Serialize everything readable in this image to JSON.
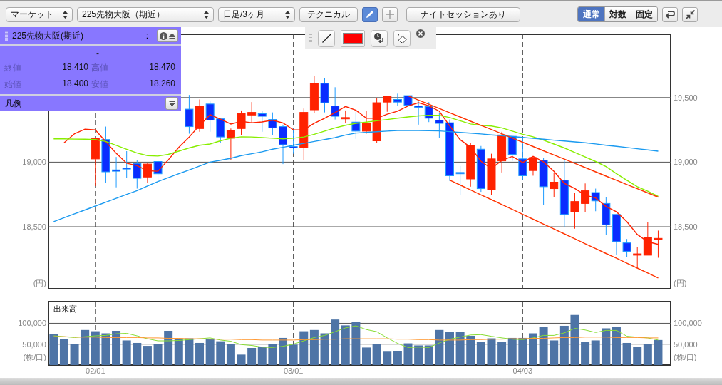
{
  "toolbar": {
    "selects": [
      {
        "value": "マーケット"
      },
      {
        "value": "225先物大阪（期近）"
      },
      {
        "value": "日足/3ヶ月"
      }
    ],
    "technical_button": "テクニカル",
    "tool_buttons": [
      {
        "kind": "pencil",
        "selected": true
      },
      {
        "kind": "plus",
        "selected": false
      }
    ],
    "night_session_button": "ナイトセッションあり",
    "scale_tabs": [
      {
        "label": "通常",
        "selected": true
      },
      {
        "label": "対数",
        "selected": false
      },
      {
        "label": "固定",
        "selected": false
      }
    ]
  },
  "info_panel": {
    "title": "225先物大阪(期近)",
    "separator": ":",
    "date": "-",
    "fields": [
      {
        "label": "終値",
        "value": "18,410"
      },
      {
        "label": "高値",
        "value": "18,470"
      },
      {
        "label": "始値",
        "value": "18,400"
      },
      {
        "label": "安値",
        "value": "18,260"
      }
    ],
    "legend_label": "凡例"
  },
  "draw_toolbar": {
    "color": "#ff0000"
  },
  "main_chart": {
    "unit_left": "(円)",
    "unit_right": "(円)",
    "chart_data": {
      "type": "candlestick",
      "grid": true,
      "ylim": [
        18020,
        19990
      ],
      "yticks": [
        {
          "value": 18500,
          "label": "18,500"
        },
        {
          "value": 19000,
          "label": "19,000"
        },
        {
          "value": 19500,
          "label": "19,500"
        }
      ],
      "categories": [
        null,
        null,
        null,
        null,
        null,
        null,
        null,
        null,
        null,
        null,
        null,
        null,
        null,
        null,
        null,
        null,
        null,
        null,
        null,
        null,
        null,
        null,
        null,
        null,
        null,
        null,
        null,
        null,
        null,
        null,
        null,
        null,
        null,
        null,
        null,
        null,
        null,
        null,
        null,
        null,
        null,
        null,
        null,
        null,
        null,
        null,
        null,
        null,
        null,
        null,
        null,
        null,
        null,
        null,
        null,
        null,
        null,
        null,
        null
      ],
      "ohlc": [
        null,
        null,
        null,
        null,
        [
          19025,
          19185,
          18815,
          19185
        ],
        [
          19175,
          19275,
          18840,
          18925
        ],
        [
          18940,
          19040,
          18805,
          18930
        ],
        [
          18955,
          19085,
          18880,
          18950
        ],
        [
          18990,
          19015,
          18795,
          18875
        ],
        [
          18885,
          18995,
          18840,
          18985
        ],
        [
          19005,
          19020,
          18860,
          18910
        ],
        null,
        null,
        [
          19410,
          19520,
          19220,
          19275
        ],
        [
          19260,
          19485,
          19235,
          19435
        ],
        [
          19450,
          19470,
          19235,
          19325
        ],
        [
          19335,
          19335,
          19150,
          19195
        ],
        [
          19185,
          19260,
          19015,
          19245
        ],
        [
          19260,
          19400,
          19210,
          19375
        ],
        [
          19365,
          19465,
          19305,
          19385
        ],
        [
          19375,
          19395,
          19235,
          19355
        ],
        [
          19330,
          19385,
          19210,
          19265
        ],
        [
          19275,
          19290,
          18985,
          19135
        ],
        [
          19120,
          19260,
          19065,
          19110
        ],
        [
          19110,
          19415,
          19015,
          19385
        ],
        [
          19405,
          19670,
          19380,
          19610
        ],
        [
          19610,
          19650,
          19385,
          19460
        ],
        [
          19435,
          19580,
          19330,
          19355
        ],
        [
          19335,
          19400,
          19300,
          19345
        ],
        [
          19310,
          19390,
          19180,
          19240
        ],
        [
          19240,
          19395,
          19220,
          19300
        ],
        [
          19165,
          19495,
          19150,
          19460
        ],
        [
          19465,
          19510,
          19390,
          19510
        ],
        [
          19485,
          19530,
          19435,
          19465
        ],
        [
          19515,
          19515,
          19360,
          19440
        ],
        [
          19435,
          19470,
          19290,
          19425
        ],
        [
          19430,
          19465,
          19310,
          19340
        ],
        [
          19325,
          19380,
          19190,
          19300
        ],
        [
          19305,
          19330,
          18855,
          18895
        ],
        [
          18920,
          18970,
          18745,
          18910
        ],
        [
          18870,
          19150,
          18810,
          19130
        ],
        [
          19100,
          19125,
          18770,
          18795
        ],
        [
          18785,
          19065,
          18745,
          19025
        ],
        [
          19010,
          19235,
          18920,
          19210
        ],
        [
          19200,
          19200,
          19010,
          19060
        ],
        [
          19025,
          19195,
          18865,
          18895
        ],
        [
          18935,
          19045,
          18895,
          19035
        ],
        [
          19015,
          19035,
          18670,
          18810
        ],
        [
          18795,
          18920,
          18730,
          18845
        ],
        [
          18860,
          19020,
          18500,
          18595
        ],
        [
          18615,
          18760,
          18485,
          18695
        ],
        [
          18680,
          18835,
          18615,
          18780
        ],
        [
          18765,
          18795,
          18620,
          18700
        ],
        [
          18680,
          18730,
          18435,
          18515
        ],
        [
          18595,
          18595,
          18285,
          18385
        ],
        [
          18375,
          18405,
          18265,
          18310
        ],
        [
          18280,
          18340,
          18180,
          18290
        ],
        [
          18280,
          18535,
          18280,
          18420
        ],
        [
          18400,
          18470,
          18260,
          18410
        ]
      ],
      "series": [
        {
          "type": "line",
          "color": "#ff2200",
          "values": [
            null,
            19150,
            19220,
            19255,
            19249,
            19158,
            19068,
            18992,
            18973,
            18933,
            18930,
            19018,
            19114,
            19194,
            19284,
            19367,
            19332,
            19295,
            19315,
            19305,
            19311,
            19325,
            19303,
            19250,
            19250,
            19301,
            19340,
            19384,
            19431,
            19402,
            19340,
            19340,
            19371,
            19395,
            19435,
            19460,
            19436,
            19394,
            19280,
            19174,
            19115,
            19006,
            18951,
            19014,
            19044,
            18997,
            19045,
            19002,
            18929,
            18836,
            18796,
            18745,
            18723,
            18657,
            18615,
            18538,
            18440,
            18384,
            18363
          ]
        },
        {
          "type": "line",
          "color": "#88ee00",
          "values": [
            19180,
            19180,
            19178,
            19177,
            19175,
            19160,
            19130,
            19100,
            19070,
            19050,
            19047,
            19060,
            19085,
            19110,
            19130,
            19140,
            19165,
            19185,
            19196,
            19195,
            19190,
            19185,
            19180,
            19185,
            19195,
            19215,
            19240,
            19265,
            19285,
            19300,
            19310,
            19320,
            19330,
            19340,
            19350,
            19358,
            19362,
            19362,
            19345,
            19320,
            19295,
            19285,
            19280,
            19265,
            19240,
            19215,
            19196,
            19170,
            19140,
            19110,
            19075,
            19040,
            19005,
            18965,
            18910,
            18860,
            18810,
            18775,
            18735
          ]
        },
        {
          "type": "line",
          "color": "#1a9af0",
          "values": [
            18540,
            18570,
            18600,
            18630,
            18660,
            18690,
            18720,
            18750,
            18780,
            18815,
            18850,
            18880,
            18910,
            18940,
            18970,
            19000,
            19015,
            19030,
            19050,
            19065,
            19080,
            19100,
            19115,
            19130,
            19145,
            19160,
            19175,
            19190,
            19210,
            19225,
            19230,
            19235,
            19240,
            19245,
            19245,
            19245,
            19243,
            19242,
            19236,
            19230,
            19224,
            19218,
            19211,
            19205,
            19198,
            19191,
            19184,
            19177,
            19170,
            19164,
            19157,
            19150,
            19141,
            19131,
            19122,
            19113,
            19104,
            19095,
            19085
          ]
        },
        {
          "type": "line",
          "color": "#ff3300",
          "values": [
            null,
            null,
            null,
            null,
            null,
            null,
            null,
            null,
            null,
            null,
            null,
            null,
            null,
            null,
            null,
            null,
            null,
            null,
            null,
            null,
            null,
            null,
            null,
            null,
            null,
            null,
            null,
            null,
            null,
            null,
            null,
            null,
            null,
            null,
            19513,
            19480,
            19448,
            19415,
            19382,
            19350,
            19317,
            19284,
            19252,
            19219,
            19186,
            19154,
            19121,
            19088,
            19056,
            19023,
            18990,
            18958,
            18925,
            18892,
            18860,
            18827,
            18794,
            18762,
            18729
          ]
        },
        {
          "type": "line",
          "color": "#ff3300",
          "values": [
            null,
            null,
            null,
            null,
            null,
            null,
            null,
            null,
            null,
            null,
            null,
            null,
            null,
            null,
            null,
            null,
            null,
            null,
            null,
            null,
            null,
            null,
            null,
            null,
            null,
            null,
            null,
            null,
            null,
            null,
            null,
            null,
            null,
            null,
            null,
            null,
            null,
            null,
            18861,
            18823,
            18785,
            18747,
            18710,
            18672,
            18634,
            18596,
            18558,
            18520,
            18483,
            18445,
            18407,
            18369,
            18331,
            18293,
            18256,
            18218,
            18180,
            18142,
            18104
          ]
        }
      ]
    }
  },
  "volume_chart": {
    "unit_left": "(株/口)",
    "unit_right": "(株/口)",
    "chart_data": {
      "type": "bar",
      "title": "出来高",
      "grid": true,
      "ylim": [
        0,
        152000
      ],
      "yticks": [
        {
          "value": 50000,
          "label": "50,000"
        },
        {
          "value": 100000,
          "label": "100,000"
        }
      ],
      "categories": [
        null,
        null,
        null,
        null,
        "02/01",
        null,
        null,
        null,
        null,
        null,
        null,
        null,
        null,
        null,
        null,
        null,
        null,
        null,
        null,
        null,
        null,
        null,
        null,
        "03/01",
        null,
        null,
        null,
        null,
        null,
        null,
        null,
        null,
        null,
        null,
        null,
        null,
        null,
        null,
        null,
        null,
        null,
        null,
        null,
        null,
        null,
        "04/03",
        null,
        null,
        null,
        null,
        null,
        null,
        null,
        null,
        null,
        null,
        null,
        null,
        null
      ],
      "series": [
        {
          "type": "bar",
          "color": "#4e74a6",
          "values": [
            74000,
            62000,
            50000,
            84000,
            81000,
            76000,
            82000,
            59000,
            53000,
            46000,
            51000,
            82000,
            64000,
            64000,
            53000,
            62000,
            57000,
            50000,
            25000,
            41000,
            43000,
            51000,
            65000,
            49000,
            81000,
            84000,
            76000,
            109000,
            95000,
            104000,
            42000,
            50000,
            32000,
            33000,
            52000,
            47000,
            47000,
            84000,
            79000,
            79000,
            70000,
            55000,
            64000,
            56000,
            65000,
            65000,
            76000,
            91000,
            59000,
            94000,
            120000,
            56000,
            59000,
            88000,
            91000,
            53000,
            44000,
            51000,
            60000
          ]
        },
        {
          "type": "line",
          "color": "#88dd33",
          "values": [
            70000,
            68000,
            66000,
            68000,
            70000,
            71000,
            75000,
            76000,
            70000,
            63000,
            58000,
            58000,
            59000,
            61000,
            63000,
            65000,
            60000,
            57000,
            49000,
            47000,
            43000,
            42000,
            45000,
            50000,
            58000,
            66000,
            71000,
            80000,
            89000,
            94000,
            85000,
            80000,
            65000,
            52000,
            42000,
            43000,
            42000,
            53000,
            62000,
            67000,
            72000,
            73000,
            69000,
            65000,
            62000,
            61000,
            65000,
            71000,
            71000,
            77000,
            88000,
            84000,
            78000,
            83000,
            83000,
            69000,
            67000,
            65000,
            60000
          ]
        },
        {
          "type": "line",
          "color": "#ff9933",
          "values": [
            68000,
            68000,
            67000,
            67000,
            67000,
            66000,
            66000,
            66000,
            66000,
            65000,
            65000,
            64000,
            64000,
            63000,
            63000,
            62000,
            62000,
            62000,
            61000,
            61000,
            60000,
            60000,
            60000,
            60000,
            61000,
            61000,
            62000,
            62000,
            63000,
            63000,
            63000,
            63000,
            63000,
            62000,
            62000,
            61000,
            61000,
            60000,
            60000,
            60000,
            61000,
            61000,
            62000,
            62000,
            63000,
            63000,
            64000,
            64000,
            65000,
            66000,
            66000,
            67000,
            67000,
            67000,
            66000,
            66000,
            66000,
            65000,
            65000
          ]
        }
      ]
    }
  }
}
